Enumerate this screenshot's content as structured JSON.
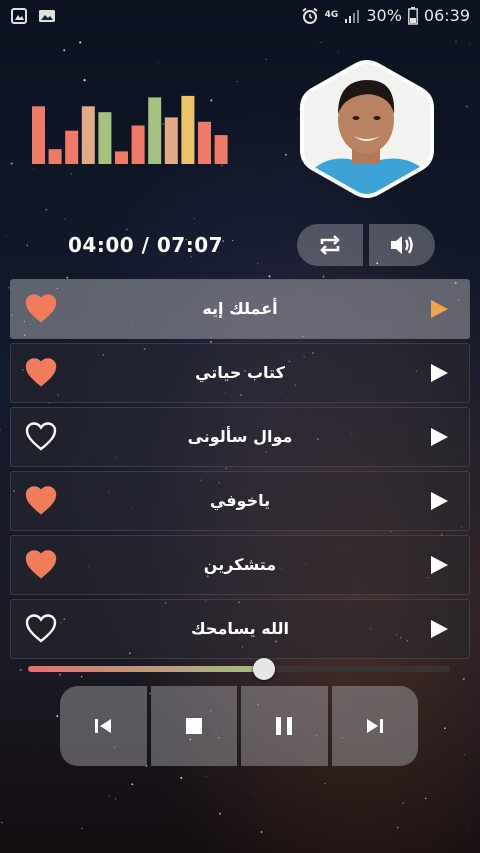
{
  "status_bar": {
    "battery": "30%",
    "time": "06:39",
    "network": "4G",
    "icons": [
      "gallery-icon",
      "image-icon",
      "alarm-icon",
      "signal-icon",
      "battery-icon"
    ]
  },
  "equalizer_level": [
    0.78,
    0.2,
    0.45,
    0.78,
    0.7,
    0.17,
    0.52,
    0.9,
    0.63,
    0.92,
    0.57,
    0.39
  ],
  "equalizer_colors": [
    "#ef7a68",
    "#ef7a68",
    "#ef7a68",
    "#e0ab86",
    "#a6c080",
    "#ef7a68",
    "#ef7a68",
    "#a6c080",
    "#e0ab86",
    "#ebc46a",
    "#ef7a68",
    "#ef7a68"
  ],
  "player": {
    "time_display": "04:00 / 07:07",
    "progress": 0.56,
    "repeat_icon": "repeat-icon",
    "volume_icon": "volume-icon"
  },
  "tracks": [
    {
      "title": "أعملك إيه",
      "favorite": true,
      "active": true
    },
    {
      "title": "كتاب حياتي",
      "favorite": true,
      "active": false
    },
    {
      "title": "موال سألونى",
      "favorite": false,
      "active": false
    },
    {
      "title": "ياخوفي",
      "favorite": true,
      "active": false
    },
    {
      "title": "متشكرين",
      "favorite": true,
      "active": false
    },
    {
      "title": "الله يسامحك",
      "favorite": false,
      "active": false
    }
  ],
  "controls": [
    "previous-icon",
    "stop-icon",
    "pause-icon",
    "next-icon"
  ],
  "colors": {
    "heart": "#f07c5c",
    "play_active": "#f4a24c",
    "accent_fill_start": "#e07070",
    "accent_fill_end": "#9fc07f"
  }
}
